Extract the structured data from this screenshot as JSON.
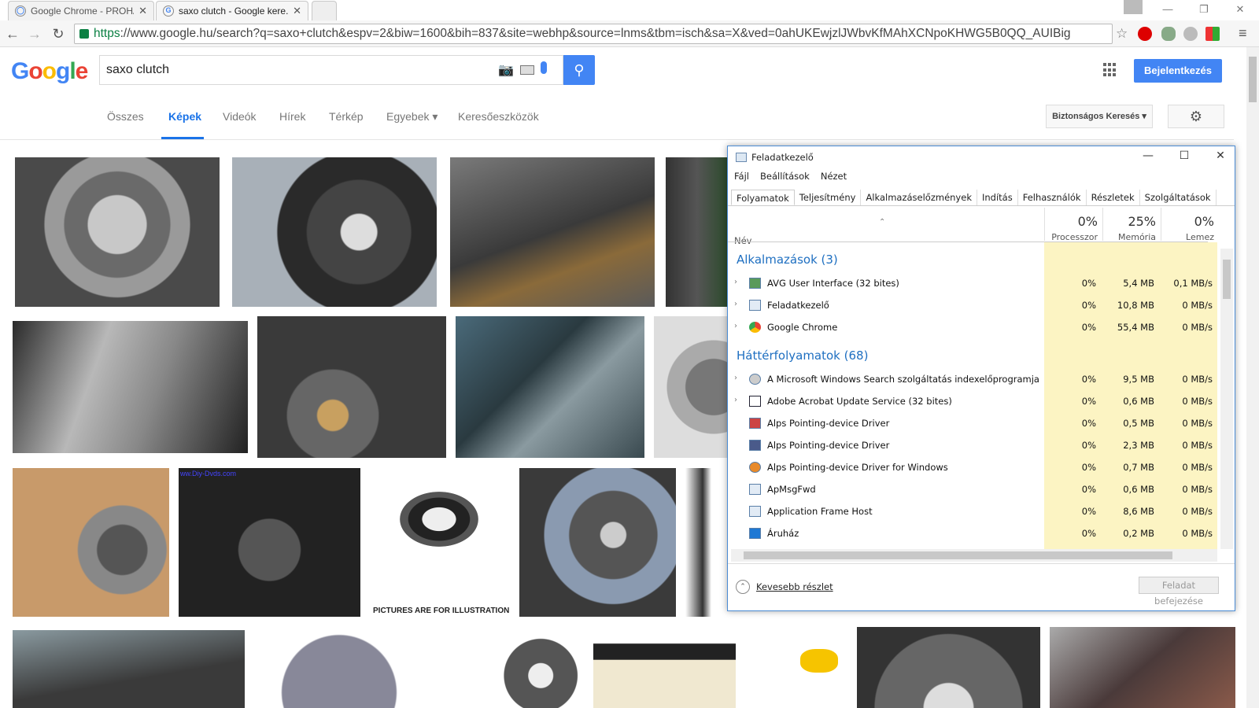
{
  "browser": {
    "tabs": [
      {
        "title": "Google Chrome - PROHA..."
      },
      {
        "title": "saxo clutch - Google kere..."
      }
    ],
    "url_scheme": "https",
    "url_rest": "://www.google.hu/search?q=saxo+clutch&espv=2&biw=1600&bih=837&site=webhp&source=lnms&tbm=isch&sa=X&ved=0ahUKEwjzlJWbvKfMAhXCNpoKHWG5B0QQ_AUIBig"
  },
  "google": {
    "logo": "Google",
    "query": "saxo clutch",
    "signin": "Bejelentkezés",
    "nav": [
      "Összes",
      "Képek",
      "Videók",
      "Hírek",
      "Térkép",
      "Egyebek ▾",
      "Keresőeszközök"
    ],
    "safesearch": "Biztonságos Keresés ▾",
    "image_caption": "PICTURES ARE FOR ILLUSTRATION",
    "watermark": "ww.Diy-Dvds.com"
  },
  "taskmanager": {
    "title": "Feladatkezelő",
    "menu": [
      "Fájl",
      "Beállítások",
      "Nézet"
    ],
    "tabs": [
      "Folyamatok",
      "Teljesítmény",
      "Alkalmazáselőzmények",
      "Indítás",
      "Felhasználók",
      "Részletek",
      "Szolgáltatások"
    ],
    "name_header": "Név",
    "columns": [
      {
        "pct": "0%",
        "name": "Processzor"
      },
      {
        "pct": "25%",
        "name": "Memória"
      },
      {
        "pct": "0%",
        "name": "Lemez"
      }
    ],
    "group_apps": "Alkalmazások (3)",
    "apps": [
      {
        "name": "AVG User Interface (32 bites)",
        "cpu": "0%",
        "mem": "5,4 MB",
        "disk": "0,1 MB/s"
      },
      {
        "name": "Feladatkezelő",
        "cpu": "0%",
        "mem": "10,8 MB",
        "disk": "0 MB/s"
      },
      {
        "name": "Google Chrome",
        "cpu": "0%",
        "mem": "55,4 MB",
        "disk": "0 MB/s"
      }
    ],
    "group_bg": "Háttérfolyamatok (68)",
    "background": [
      {
        "name": "A Microsoft Windows Search szolgáltatás indexelőprogramja",
        "cpu": "0%",
        "mem": "9,5 MB",
        "disk": "0 MB/s"
      },
      {
        "name": "Adobe Acrobat Update Service (32 bites)",
        "cpu": "0%",
        "mem": "0,6 MB",
        "disk": "0 MB/s"
      },
      {
        "name": "Alps Pointing-device Driver",
        "cpu": "0%",
        "mem": "0,5 MB",
        "disk": "0 MB/s"
      },
      {
        "name": "Alps Pointing-device Driver",
        "cpu": "0%",
        "mem": "2,3 MB",
        "disk": "0 MB/s"
      },
      {
        "name": "Alps Pointing-device Driver for Windows",
        "cpu": "0%",
        "mem": "0,7 MB",
        "disk": "0 MB/s"
      },
      {
        "name": "ApMsgFwd",
        "cpu": "0%",
        "mem": "0,6 MB",
        "disk": "0 MB/s"
      },
      {
        "name": "Application Frame Host",
        "cpu": "0%",
        "mem": "8,6 MB",
        "disk": "0 MB/s"
      },
      {
        "name": "Áruház",
        "cpu": "0%",
        "mem": "0,2 MB",
        "disk": "0 MB/s"
      }
    ],
    "fewer_details": "Kevesebb részlet",
    "end_task": "Feladat befejezése"
  }
}
